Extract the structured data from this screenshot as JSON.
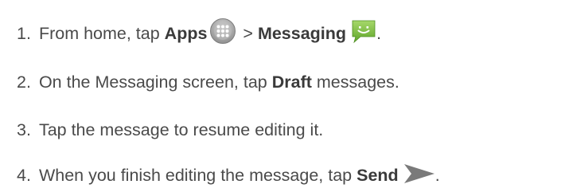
{
  "steps": [
    {
      "number": "1.",
      "text_a": "From home, tap ",
      "bold_a": "Apps",
      "text_b": " > ",
      "bold_b": "Messaging",
      "text_c": ".",
      "icons": [
        "apps-grid-icon",
        "messaging-icon"
      ]
    },
    {
      "number": "2.",
      "text_a": "On the Messaging screen, tap ",
      "bold_a": "Draft",
      "text_b": " messages."
    },
    {
      "number": "3.",
      "text_a": "Tap the message to resume editing it."
    },
    {
      "number": "4.",
      "text_a": "When you finish editing the message, tap ",
      "bold_a": "Send",
      "text_b": ".",
      "icons": [
        "send-arrow-icon"
      ]
    }
  ],
  "colors": {
    "text": "#4a4a4a",
    "messaging_icon_green": "#7cbf3e",
    "apps_icon_gray": "#9a9a9a",
    "send_icon_gray": "#7a7a7a"
  }
}
